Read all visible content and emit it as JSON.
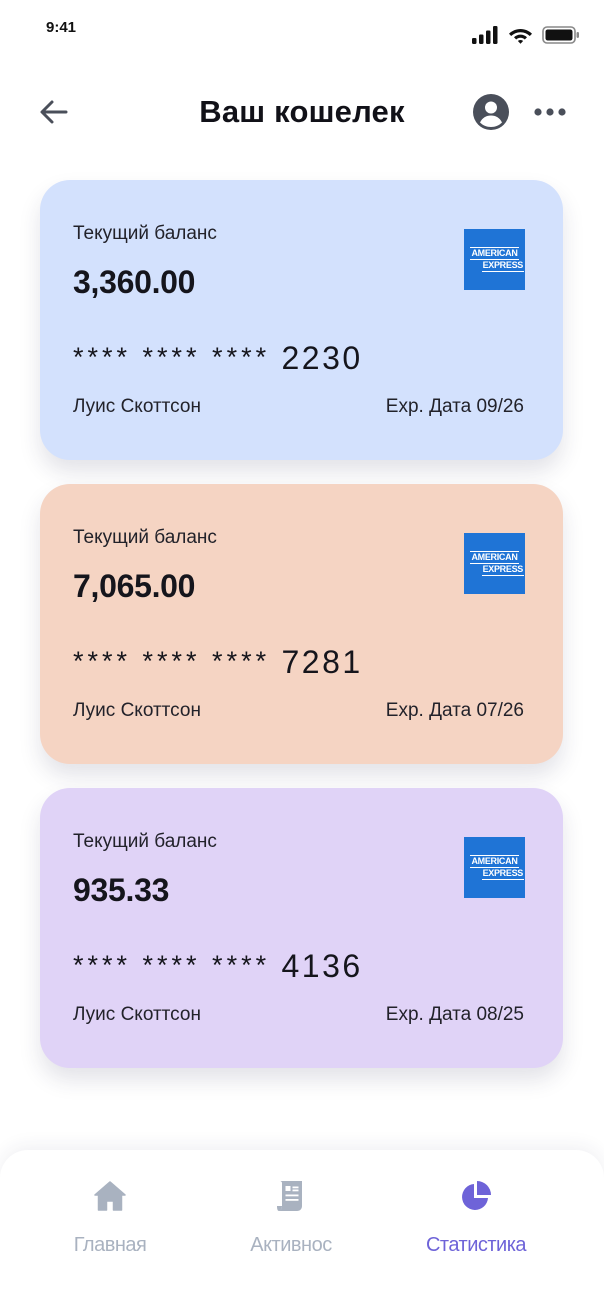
{
  "status_bar": {
    "time": "9:41"
  },
  "header": {
    "title": "Ваш кошелек"
  },
  "cards": [
    {
      "label": "Текущий баланс",
      "balance": "3,360.00",
      "number_mask": "**** **** ****",
      "number_last4": "2230",
      "holder": "Луис Скоттсон",
      "expiry": "Exp. Дата 09/26",
      "brand_line1": "AMERICAN",
      "brand_line2": "EXPRESS",
      "color": "#d3e1fd"
    },
    {
      "label": "Текущий баланс",
      "balance": "7,065.00",
      "number_mask": "**** **** ****",
      "number_last4": "7281",
      "holder": "Луис Скоттсон",
      "expiry": "Exp. Дата 07/26",
      "brand_line1": "AMERICAN",
      "brand_line2": "EXPRESS",
      "color": "#f5d4c3"
    },
    {
      "label": "Текущий баланс",
      "balance": "935.33",
      "number_mask": "**** **** ****",
      "number_last4": "4136",
      "holder": "Луис Скоттсон",
      "expiry": "Exp. Дата 08/25",
      "brand_line1": "AMERICAN",
      "brand_line2": "EXPRESS",
      "color": "#e0d3f7"
    }
  ],
  "bottom_nav": {
    "items": [
      {
        "label": "Главная",
        "icon": "home-icon",
        "active": false
      },
      {
        "label": "Активнос",
        "icon": "activity-receipt-icon",
        "active": false
      },
      {
        "label": "Статистика",
        "icon": "pie-chart-icon",
        "active": true
      }
    ]
  },
  "colors": {
    "amex_blue": "#1f74d6",
    "accent_active": "#6e63d8",
    "nav_inactive": "#a9b2c0"
  }
}
